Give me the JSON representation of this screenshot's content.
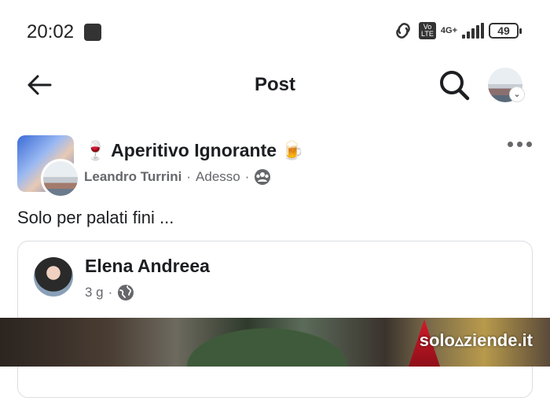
{
  "status_bar": {
    "time": "20:02",
    "volte_label": "Vo\nLTE",
    "network": "4G+",
    "battery": "49"
  },
  "topbar": {
    "title": "Post"
  },
  "post": {
    "group_name": "🍷 Aperitivo Ignorante 🍺",
    "author": "Leandro Turrini",
    "separator": "·",
    "time": "Adesso",
    "text": "Solo per palati fini ...",
    "shared": {
      "name": "Elena Andreea",
      "time": "3 g",
      "separator": "·"
    }
  },
  "watermark": "solo▵ziende.it",
  "icons": {
    "back": "arrow-left-icon",
    "search": "search-icon",
    "more": "more-icon",
    "audience_group": "group-audience-icon",
    "audience_public": "globe-icon"
  }
}
